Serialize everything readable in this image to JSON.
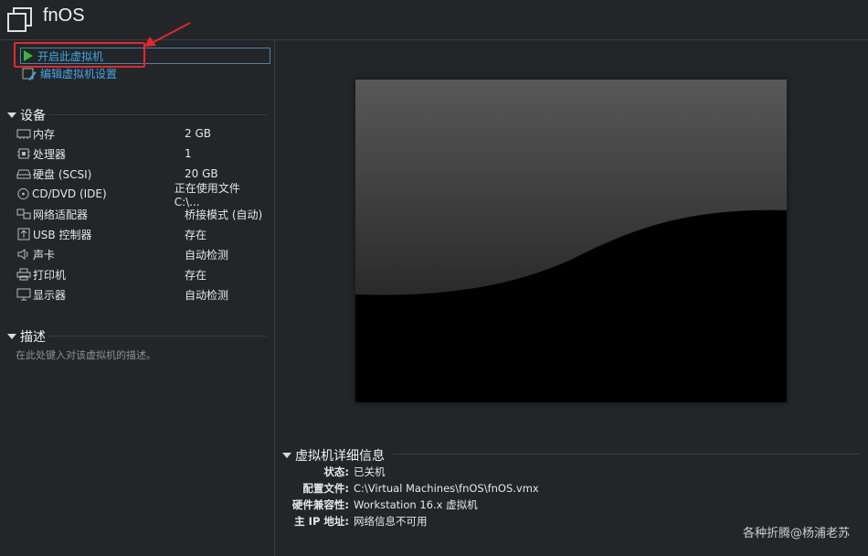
{
  "vm": {
    "title": "fnOS"
  },
  "actions": {
    "power_on": "开启此虚拟机",
    "edit_settings": "编辑虚拟机设置"
  },
  "devices": {
    "header": "设备",
    "items": [
      {
        "icon": "memory-icon",
        "name": "内存",
        "value": "2 GB"
      },
      {
        "icon": "processor-icon",
        "name": "处理器",
        "value": "1"
      },
      {
        "icon": "hard-disk-icon",
        "name": "硬盘 (SCSI)",
        "value": "20 GB"
      },
      {
        "icon": "cd-dvd-icon",
        "name": "CD/DVD (IDE)",
        "value": "正在使用文件 C:\\..."
      },
      {
        "icon": "network-adapter-icon",
        "name": "网络适配器",
        "value": "桥接模式 (自动)"
      },
      {
        "icon": "usb-controller-icon",
        "name": "USB 控制器",
        "value": "存在"
      },
      {
        "icon": "sound-card-icon",
        "name": "声卡",
        "value": "自动检测"
      },
      {
        "icon": "printer-icon",
        "name": "打印机",
        "value": "存在"
      },
      {
        "icon": "display-icon",
        "name": "显示器",
        "value": "自动检测"
      }
    ]
  },
  "description": {
    "header": "描述",
    "placeholder": "在此处键入对该虚拟机的描述。"
  },
  "details": {
    "header": "虚拟机详细信息",
    "rows": [
      {
        "key": "状态:",
        "value": "已关机"
      },
      {
        "key": "配置文件:",
        "value": "C:\\Virtual Machines\\fnOS\\fnOS.vmx"
      },
      {
        "key": "硬件兼容性:",
        "value": "Workstation 16.x 虚拟机"
      },
      {
        "key": "主 IP 地址:",
        "value": "网络信息不可用"
      }
    ]
  },
  "watermark": "各种折腾@杨浦老苏",
  "colors": {
    "accent": "#3fa8e8",
    "highlight": "#e8262b",
    "play": "#3cb43c"
  }
}
